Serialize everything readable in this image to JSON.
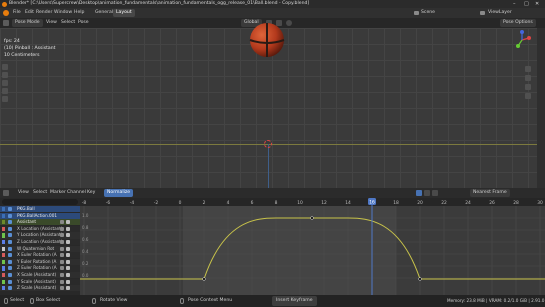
{
  "window": {
    "title": "Blender* [C:\\Users\\Supercrew\\Desktop\\animation_fundamentals\\animation_fundamentals_ogg_release_01\\Ball.blend - Copy.blend]",
    "controls": [
      "–",
      "□",
      "✕"
    ]
  },
  "menubar": {
    "items": [
      "File",
      "Edit",
      "Render",
      "Window",
      "Help"
    ],
    "workspaces": [
      "General",
      "Layout"
    ],
    "active_workspace": "Layout",
    "scene_label": "Scene",
    "view_layer_label": "ViewLayer"
  },
  "viewport_header": {
    "mode": "Pose Mode",
    "menus": [
      "View",
      "Select",
      "Pose"
    ],
    "orientation": "Global",
    "pose_options": "Pose Options"
  },
  "viewport": {
    "info": [
      "fps: 24",
      "(10) Pinball : Assistant",
      "10 Centimeters"
    ],
    "ball_colors": {
      "main": "#b3391c",
      "dark": "#2a1a14",
      "highlight": "#e0653a"
    }
  },
  "graph_header": {
    "menus": [
      "View",
      "Select",
      "Marker",
      "Channel",
      "Key"
    ],
    "mode": "Normalize",
    "pivot": "Nearest Frame"
  },
  "timeline": {
    "frames": [
      "-8",
      "-6",
      "-4",
      "-2",
      "0",
      "2",
      "4",
      "6",
      "8",
      "10",
      "12",
      "14",
      "16",
      "18",
      "20",
      "22",
      "24",
      "26",
      "28",
      "30"
    ],
    "current_frame": "16",
    "y_labels": [
      "1.0",
      "0.8",
      "0.6",
      "0.4",
      "0.2",
      "0.0"
    ]
  },
  "channels": [
    {
      "label": "PKG.Ball",
      "color": "#3b6fb6",
      "kind": "object"
    },
    {
      "label": "PKG.BallAction.001",
      "color": "#3b6fb6",
      "kind": "action"
    },
    {
      "label": "Assistant",
      "color": "#6c8a2c",
      "kind": "group"
    },
    {
      "label": "X Location (Assistant)",
      "color": "#d65b5b",
      "kind": "fcurve"
    },
    {
      "label": "Y Location (Assistant)",
      "color": "#6fc44c",
      "kind": "fcurve"
    },
    {
      "label": "Z Location (Assistant)",
      "color": "#5c7ee6",
      "kind": "fcurve"
    },
    {
      "label": "W Quaternion Rot",
      "color": "#c9c9c9",
      "kind": "fcurve"
    },
    {
      "label": "X Euler Rotation (A",
      "color": "#d65b5b",
      "kind": "fcurve"
    },
    {
      "label": "Y Euler Rotation (A",
      "color": "#6fc44c",
      "kind": "fcurve"
    },
    {
      "label": "Z Euler Rotation (A",
      "color": "#5c7ee6",
      "kind": "fcurve"
    },
    {
      "label": "X Scale (Assistant)",
      "color": "#d65b5b",
      "kind": "fcurve"
    },
    {
      "label": "Y Scale (Assistant)",
      "color": "#6fc44c",
      "kind": "fcurve"
    },
    {
      "label": "Z Scale (Assistant)",
      "color": "#5c7ee6",
      "kind": "fcurve"
    }
  ],
  "statusbar": {
    "left": [
      "Select",
      "Box Select",
      "Rotate View",
      "Pose Context Menu"
    ],
    "center": "Insert Keyframe",
    "right": "Memory: 23.8 MiB | VRAM: 0.2/1.0 GiB | 2.91.0"
  },
  "colors": {
    "accent": "#4772b3",
    "curve": "#c8c34a",
    "playhead": "#4f78c6",
    "active_channel": "#2c4a7a"
  }
}
